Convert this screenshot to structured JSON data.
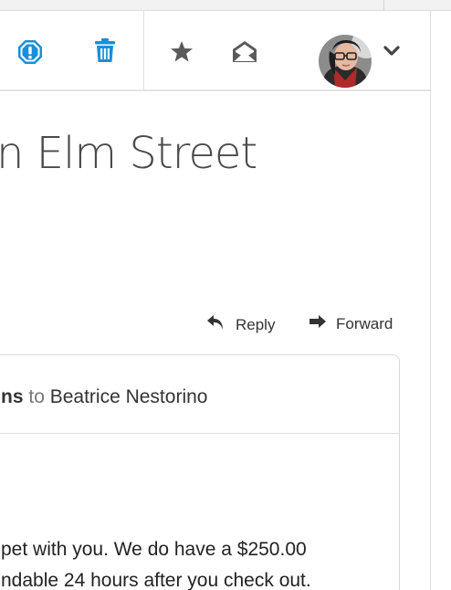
{
  "toolbar": {
    "icons": [
      "spam-icon",
      "trash-icon",
      "star-icon",
      "mark-unread-icon",
      "avatar",
      "chevron-down-icon"
    ],
    "colors": {
      "accent": "#1a8fd8",
      "icon_gray": "#5a5a5a"
    }
  },
  "message": {
    "subject": "n Elm Street",
    "reply_label": "Reply",
    "forward_label": "Forward",
    "from_name": "ns",
    "to_word": "to",
    "to_name": "Beatrice Nestorino",
    "body_line1": "pet with you. We do have a $250.00",
    "body_line2": "ndable 24 hours after you check out."
  }
}
